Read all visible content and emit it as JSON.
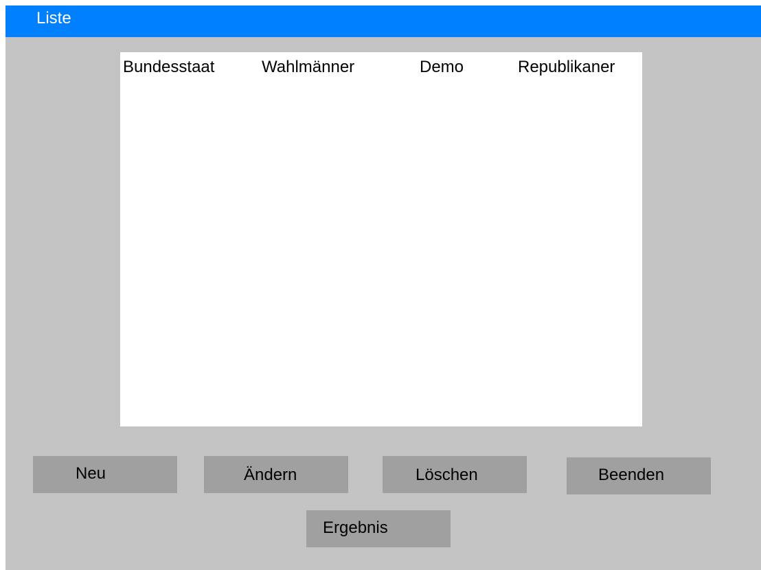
{
  "window": {
    "title": "Liste"
  },
  "list": {
    "columns": [
      "Bundesstaat",
      "Wahlmänner",
      "Demo",
      "Republikaner"
    ],
    "rows": []
  },
  "buttons": {
    "new": "Neu",
    "edit": "Ändern",
    "delete": "Löschen",
    "exit": "Beenden",
    "result": "Ergebnis"
  },
  "colors": {
    "titlebar": "#0080ff",
    "window_background": "#c3c3c3",
    "button_background": "#a0a0a0",
    "list_background": "#ffffff"
  }
}
